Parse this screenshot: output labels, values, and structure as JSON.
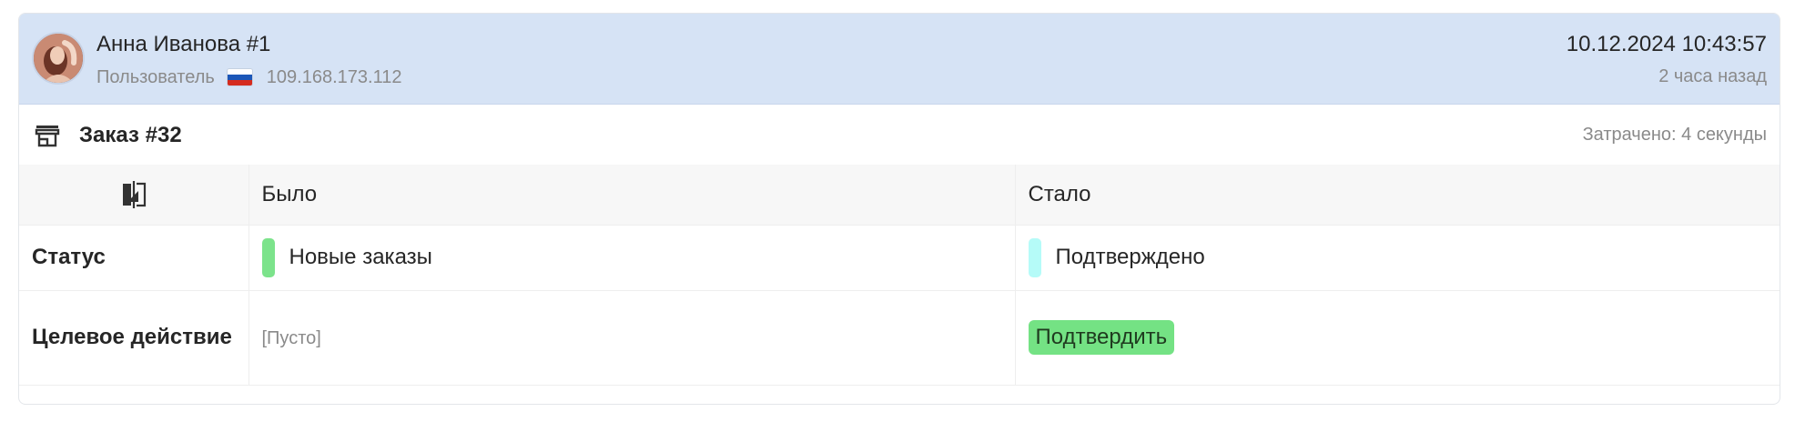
{
  "header": {
    "user_name": "Анна Иванова #1",
    "role": "Пользователь",
    "ip": "109.168.173.112",
    "datetime": "10.12.2024 10:43:57",
    "ago": "2 часа назад",
    "flag_icon": "russia-flag-icon"
  },
  "order": {
    "title": "Заказ #32",
    "spent": "Затрачено: 4 секунды",
    "icon": "shop-icon"
  },
  "table": {
    "icon": "compare-icon",
    "columns": [
      "Было",
      "Стало"
    ],
    "rows": [
      {
        "label": "Статус",
        "before": {
          "text": "Новые заказы",
          "color": "#7ce38b"
        },
        "after": {
          "text": "Подтверждено",
          "color": "#b5fbf8"
        }
      },
      {
        "label": "Целевое действие",
        "before": {
          "text": "[Пусто]"
        },
        "after": {
          "text": "Подтвердить",
          "color": "#74e284"
        }
      }
    ]
  },
  "colors": {
    "header_bg": "#d6e3f5",
    "table_header_bg": "#f7f7f7"
  }
}
